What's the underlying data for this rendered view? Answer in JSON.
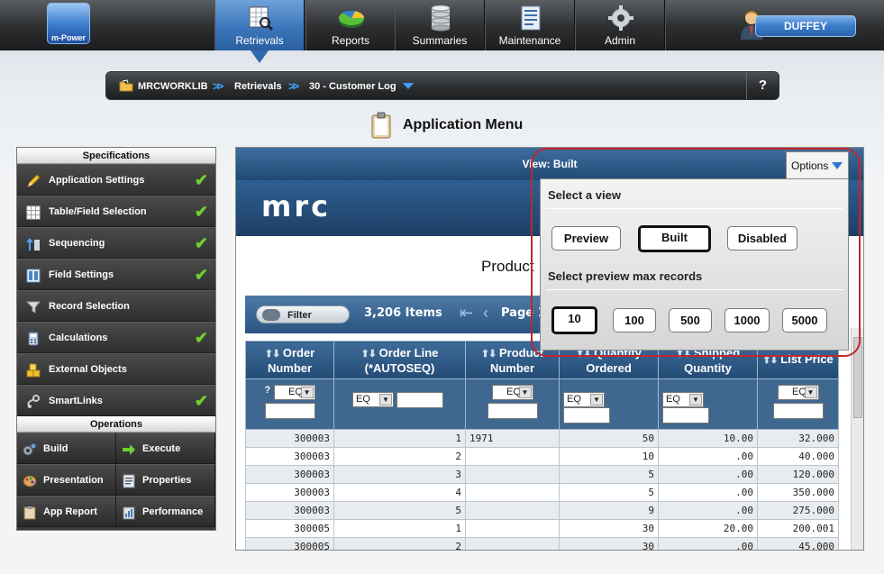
{
  "header": {
    "logo_text": "m-Power",
    "nav": [
      {
        "label": "Retrievals",
        "icon": "retrievals-icon"
      },
      {
        "label": "Reports",
        "icon": "reports-pie-icon"
      },
      {
        "label": "Summaries",
        "icon": "database-icon"
      },
      {
        "label": "Maintenance",
        "icon": "form-icon"
      },
      {
        "label": "Admin",
        "icon": "gear-icon"
      }
    ],
    "active_nav": "Retrievals",
    "user": "DUFFEY"
  },
  "breadcrumb": {
    "library": "MRCWORKLIB",
    "section": "Retrievals",
    "app": "30 - Customer Log",
    "help": "?"
  },
  "page_title": "Application Menu",
  "sidebar": {
    "specs_heading": "Specifications",
    "specs": [
      {
        "label": "Application Settings",
        "icon": "pencil-icon",
        "checked": true
      },
      {
        "label": "Table/Field Selection",
        "icon": "table-grid-icon",
        "checked": true
      },
      {
        "label": "Sequencing",
        "icon": "sort-arrows-icon",
        "checked": true
      },
      {
        "label": "Field Settings",
        "icon": "columns-icon",
        "checked": true
      },
      {
        "label": "Record Selection",
        "icon": "funnel-icon",
        "checked": false
      },
      {
        "label": "Calculations",
        "icon": "calculator-icon",
        "checked": true
      },
      {
        "label": "External Objects",
        "icon": "cubes-icon",
        "checked": false
      },
      {
        "label": "SmartLinks",
        "icon": "link-icon",
        "checked": true
      }
    ],
    "ops_heading": "Operations",
    "ops": [
      {
        "label": "Build",
        "icon": "build-gears-icon"
      },
      {
        "label": "Execute",
        "icon": "arrow-right-icon"
      },
      {
        "label": "Presentation",
        "icon": "palette-icon"
      },
      {
        "label": "Properties",
        "icon": "properties-icon"
      },
      {
        "label": "App Report",
        "icon": "report-icon"
      },
      {
        "label": "Performance",
        "icon": "performance-icon"
      }
    ]
  },
  "main": {
    "view_label": "View: Built",
    "banner_text": "mrc",
    "subtitle": "Product",
    "toolbar": {
      "filter_label": "Filter",
      "item_count": "3,206 Items",
      "page_label": "Page 1"
    },
    "columns": [
      {
        "label": "Order Number",
        "sort": "⬆⬇"
      },
      {
        "label": "Order Line (*AUTOSEQ)",
        "sort": "⬆⬇"
      },
      {
        "label": "Product Number",
        "sort": "⬆⬇"
      },
      {
        "label": "Quantity Ordered",
        "sort": "⬆⬇"
      },
      {
        "label": "Shipped Quantity",
        "sort": "⬆⬇"
      },
      {
        "label": "List Price",
        "sort": "⬆⬇"
      }
    ],
    "filter_op": "EQ",
    "filter_help": "?",
    "rows": [
      [
        "300003",
        "1",
        "1971",
        "50",
        "10.00",
        "32.000"
      ],
      [
        "300003",
        "2",
        "",
        "10",
        ".00",
        "40.000"
      ],
      [
        "300003",
        "3",
        "",
        "5",
        ".00",
        "120.000"
      ],
      [
        "300003",
        "4",
        "",
        "5",
        ".00",
        "350.000"
      ],
      [
        "300003",
        "5",
        "",
        "9",
        ".00",
        "275.000"
      ],
      [
        "300005",
        "1",
        "",
        "30",
        "20.00",
        "200.001"
      ],
      [
        "300005",
        "2",
        "",
        "30",
        ".00",
        "45.000"
      ]
    ]
  },
  "options": {
    "tab_label": "Options",
    "view_heading": "Select a view",
    "views": [
      "Preview",
      "Built",
      "Disabled"
    ],
    "selected_view": "Built",
    "max_heading": "Select preview max records",
    "max_values": [
      "10",
      "100",
      "500",
      "1000",
      "5000"
    ],
    "selected_max": "10"
  },
  "colors": {
    "accent_blue": "#2e6aac",
    "check_green": "#6fd12e",
    "highlight_red": "#c2262e"
  }
}
